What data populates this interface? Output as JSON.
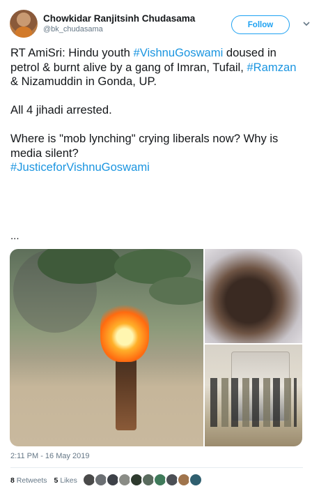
{
  "user": {
    "display_name": "Chowkidar Ranjitsinh Chudasama",
    "handle": "@bk_chudasama"
  },
  "follow_label": "Follow",
  "tweet": {
    "line1_prefix": "RT AmiSri: Hindu youth ",
    "hashtag1": "#VishnuGoswami",
    "line1_suffix": " doused in petrol & burnt alive by a gang of Imran, Tufail, ",
    "hashtag2": "#Ramzan",
    "line1_end": " & Nizamuddin in Gonda, UP.",
    "paragraph2": "All 4 jihadi arrested.",
    "paragraph3": "Where is \"mob lynching\" crying liberals now? Why is media silent?",
    "hashtag3": "#JusticeforVishnuGoswami",
    "ellipsis": "..."
  },
  "timestamp": "2:11 PM - 16 May 2019",
  "stats": {
    "retweets_count": "8",
    "retweets_label": "Retweets",
    "likes_count": "5",
    "likes_label": "Likes"
  },
  "likers": [
    "#4a4a4a",
    "#6b6f73",
    "#3d4148",
    "#8a8c86",
    "#2e3a2e",
    "#5a6b5e",
    "#3f7a5a",
    "#4b4f55",
    "#a0744c",
    "#2f5f6f"
  ],
  "colors": {
    "accent": "#1da1f2",
    "hashtag": "#1b95e0",
    "secondary_text": "#657786"
  }
}
